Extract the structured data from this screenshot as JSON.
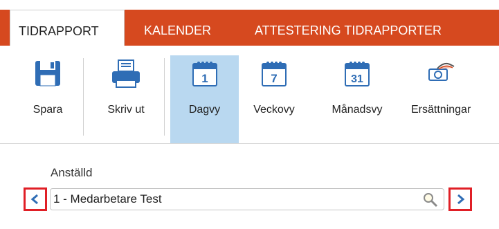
{
  "tabs": [
    {
      "label": "TIDRAPPORT",
      "active": true
    },
    {
      "label": "KALENDER",
      "active": false
    },
    {
      "label": "ATTESTERING TIDRAPPORTER",
      "active": false
    }
  ],
  "ribbon": {
    "save_label": "Spara",
    "print_label": "Skriv ut",
    "day_view_label": "Dagvy",
    "day_icon_number": "1",
    "week_view_label": "Veckovy",
    "week_icon_number": "7",
    "month_view_label": "Månadsvy",
    "month_icon_number": "31",
    "compensation_label": "Ersättningar",
    "active_view": "Dagvy"
  },
  "employee": {
    "label": "Anställd",
    "value": "1 - Medarbetare Test"
  },
  "colors": {
    "brand": "#d6491f",
    "active_button": "#b9d8f0",
    "icon_blue": "#2f6db5",
    "highlight_red": "#e01f26"
  }
}
